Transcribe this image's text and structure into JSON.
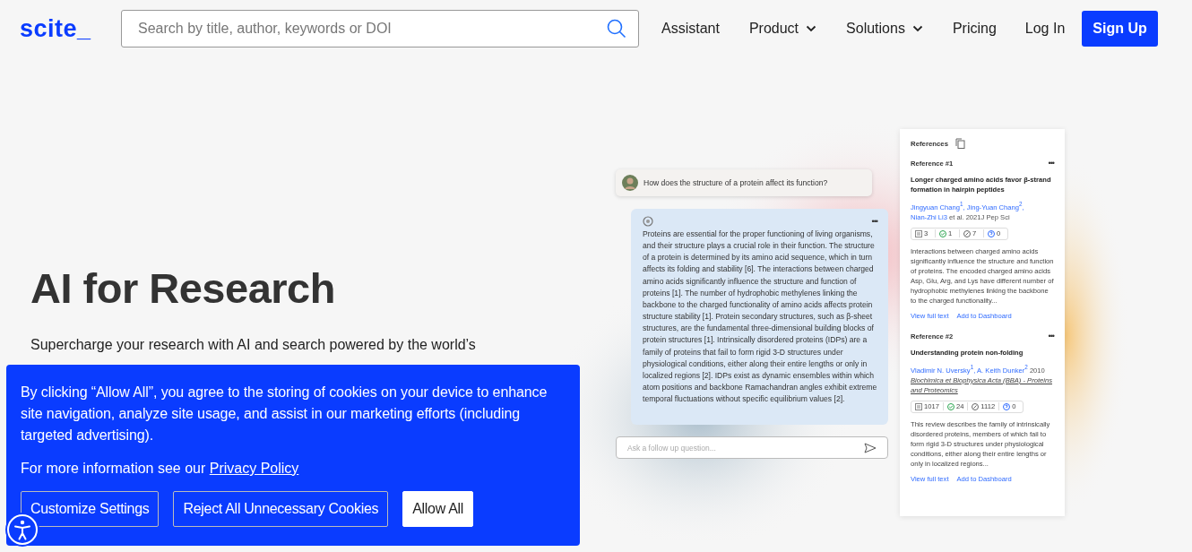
{
  "header": {
    "logo": "scite_",
    "search": {
      "placeholder": "Search by title, author, keywords or DOI"
    },
    "nav": [
      {
        "label": "Assistant",
        "dropdown": false
      },
      {
        "label": "Product",
        "dropdown": true
      },
      {
        "label": "Solutions",
        "dropdown": true
      },
      {
        "label": "Pricing",
        "dropdown": false
      },
      {
        "label": "Log In",
        "dropdown": false
      }
    ],
    "signup": "Sign Up"
  },
  "hero": {
    "title": "AI for Research",
    "subtitle": "Supercharge your research with AI and search powered by the world’s"
  },
  "chat": {
    "question": "How does the structure of a protein affect its function?",
    "answer": "Proteins are essential for the proper functioning of living organisms, and their structure plays a crucial role in their function. The structure of a protein is determined by its amino acid sequence, which in turn affects its folding and stability [6]. The interactions between charged amino acids significantly influence the structure and function of proteins [1]. The number of hydrophobic methylenes linking the backbone to the charged functionality of amino acids affects protein structure stability [1]. Protein secondary structures, such as β-sheet structures, are the fundamental three-dimensional building blocks of protein structures [1]. Intrinsically disordered proteins (IDPs) are a family of proteins that fail to form rigid 3-D structures under physiological conditions, either along their entire lengths or only in localized regions [2]. IDPs exist as dynamic ensembles within which atom positions and backbone Ramachandran angles exhibit extreme temporal fluctuations without specific equilibrium values [2].",
    "more": "•••",
    "input": {
      "placeholder": "Ask a follow up question..."
    }
  },
  "references": {
    "title": "References",
    "items": [
      {
        "label": "Reference #1",
        "more": "•••",
        "title": "Longer charged amino acids favor β-strand formation in hairpin peptides",
        "authors": [
          "Jingyuan Chang$^{1}$,",
          "Jing-Yuan Chang$^{2}$,",
          "Nian-Zhi Li3"
        ],
        "meta": "et al. 2021J Pep Sci",
        "stats": [
          {
            "kind": "citing",
            "value": "3"
          },
          {
            "kind": "supporting",
            "value": "1"
          },
          {
            "kind": "mentioning",
            "value": "7"
          },
          {
            "kind": "contrasting",
            "value": "0"
          }
        ],
        "abstract": "Interactions between charged amino acids significantly influence the structure and function of proteins. The encoded charged amino acids Asp, Glu, Arg, and Lys have different number of hydrophobic methylenes linking the backbone to the charged functionality...",
        "links": [
          "View full text",
          "Add to Dashboard"
        ]
      },
      {
        "label": "Reference #2",
        "more": "•••",
        "title": "Understanding protein non-folding",
        "authors": [
          "Vladimir N. Uversky$^{1}$,",
          "A. Keith Dunker$^{2}$"
        ],
        "meta": "2010",
        "journal": "Biochimica et Biophysica Acta (BBA) - Proteins and Proteomics",
        "stats": [
          {
            "kind": "citing",
            "value": "1017"
          },
          {
            "kind": "supporting",
            "value": "24"
          },
          {
            "kind": "mentioning",
            "value": "1112"
          },
          {
            "kind": "contrasting",
            "value": "0"
          }
        ],
        "abstract": "This review describes the family of intrinsically disordered proteins, members of which fail to form rigid 3-D structures under physiological conditions, either along their entire lengths or only in localized regions...",
        "links": [
          "View full text",
          "Add to Dashboard"
        ]
      }
    ]
  },
  "cookie_banner": {
    "text": "By clicking “Allow All”, you agree to the storing of cookies on your device to enhance site navigation, analyze site usage, and assist in our marketing efforts (including targeted advertising).",
    "info": "For more information see our",
    "link": "Privacy Policy",
    "buttons": [
      {
        "label": "Customize Settings",
        "kind": "outline"
      },
      {
        "label": "Reject All Unnecessary Cookies",
        "kind": "outline"
      },
      {
        "label": "Allow All",
        "kind": "solid"
      }
    ]
  }
}
